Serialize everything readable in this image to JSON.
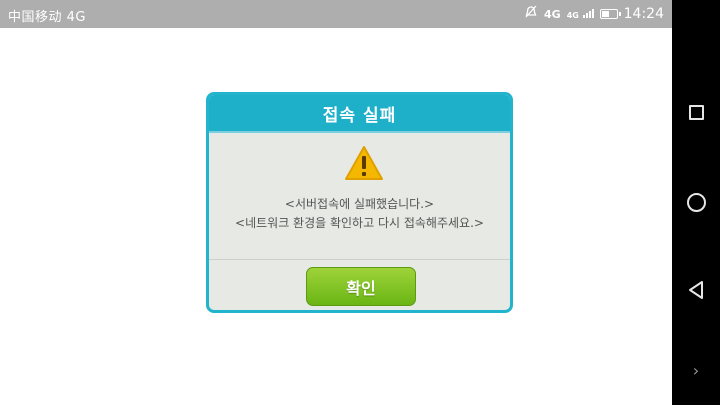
{
  "status_bar": {
    "carrier": "中国移动 4G",
    "network_label": "4G",
    "signal_label": "4G",
    "time": "14:24"
  },
  "dialog": {
    "title": "접속 실패",
    "message_line1": "<서버접속에 실패했습니다.>",
    "message_line2": "<네트워크 환경을 확인하고 다시 접속해주세요.>",
    "confirm_label": "확인"
  },
  "colors": {
    "header": "#1fb0c9",
    "button": "#7cc21f",
    "warning": "#f5b800"
  },
  "navbar": {
    "icons": [
      "square-icon",
      "circle-icon",
      "triangle-back-icon",
      "chevron-right-icon"
    ]
  }
}
